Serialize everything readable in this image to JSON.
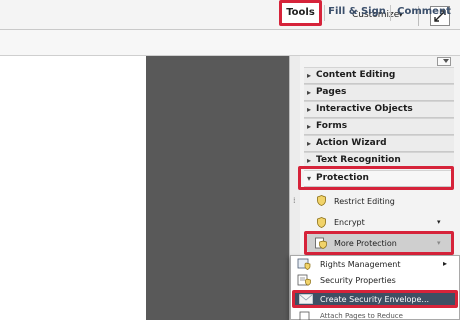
{
  "toolbar": {
    "customize_label": "Customize",
    "customize_caret": "▾"
  },
  "tabs": {
    "tools": "Tools",
    "fill_sign": "Fill & Sign",
    "comment": "Comment"
  },
  "tools_panel": {
    "sections": [
      {
        "label": "Content Editing",
        "arrow": "▸"
      },
      {
        "label": "Pages",
        "arrow": "▸"
      },
      {
        "label": "Interactive Objects",
        "arrow": "▸"
      },
      {
        "label": "Forms",
        "arrow": "▸"
      },
      {
        "label": "Action Wizard",
        "arrow": "▸"
      },
      {
        "label": "Text Recognition",
        "arrow": "▸"
      },
      {
        "label": "Protection",
        "arrow": "▾"
      }
    ],
    "protection_items": {
      "restrict_editing": "Restrict Editing",
      "encrypt": "Encrypt",
      "encrypt_caret": "▾",
      "more_protection": "More Protection",
      "more_caret": "▾"
    }
  },
  "flyout_menu": {
    "items": [
      {
        "label": "Rights Management",
        "submenu_arrow": "▸"
      },
      {
        "label": "Security Properties"
      },
      {
        "label": "Create Security Envelope..."
      },
      {
        "label": "Attach Pages to Reduce"
      }
    ]
  },
  "colors": {
    "highlight": "#d6233a",
    "menu_selected": "#3e4f63",
    "document_gray": "#595959"
  }
}
